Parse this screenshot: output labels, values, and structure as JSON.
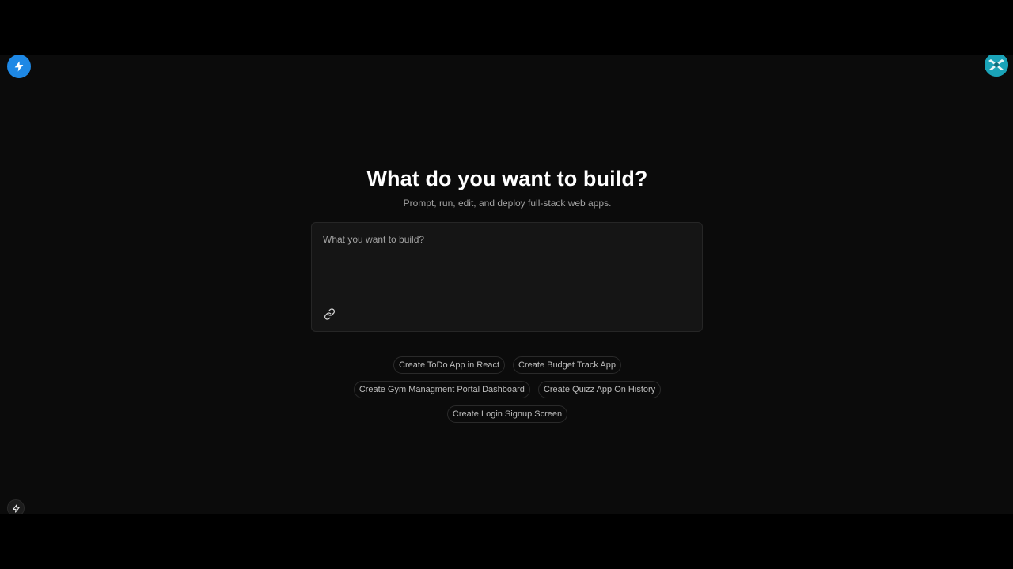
{
  "hero": {
    "title": "What do you want to build?",
    "subtitle": "Prompt, run, edit, and deploy full-stack web apps."
  },
  "prompt": {
    "placeholder": "What you want to build?",
    "value": ""
  },
  "suggestions": [
    "Create ToDo App in React",
    "Create Budget Track App",
    "Create Gym Managment Portal Dashboard",
    "Create Quizz App On History",
    "Create Login Signup Screen"
  ],
  "icons": {
    "logo": "lightning-bolt-icon",
    "avatar": "user-avatar-icon",
    "attach": "link-icon",
    "bottom": "lightning-bolt-icon"
  },
  "colors": {
    "background": "#0b0b0b",
    "letterbox": "#000000",
    "accent": "#1e88e5",
    "avatar": "#1aa3b8",
    "prompt_box": "#151515"
  }
}
